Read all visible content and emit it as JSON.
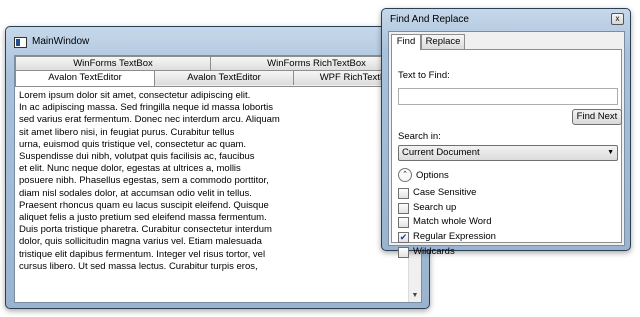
{
  "main_window": {
    "title": "MainWindow",
    "tabs_row1": [
      "WinForms TextBox",
      "WinForms RichTextBox"
    ],
    "tabs_row2": [
      "Avalon TextEditor",
      "Avalon TextEditor",
      "WPF RichTextBox"
    ],
    "active_tab": "Avalon TextEditor",
    "editor_lines": [
      "Lorem ipsum dolor sit amet, consectetur adipiscing elit.",
      "In ac adipiscing massa. Sed fringilla neque id massa lobortis",
      "sed varius erat fermentum. Donec nec interdum arcu. Aliquam",
      "sit amet libero nisi, in feugiat purus. Curabitur tellus",
      "urna, euismod quis tristique vel, consectetur ac quam.",
      "Suspendisse dui nibh, volutpat quis facilisis ac, faucibus",
      "et elit. Nunc neque dolor, egestas at ultrices a, mollis",
      "posuere nibh. Phasellus egestas, sem a commodo porttitor,",
      "diam nisl sodales dolor, at accumsan odio velit in tellus.",
      "Praesent rhoncus quam eu lacus suscipit eleifend. Quisque",
      "aliquet felis a justo pretium sed eleifend massa fermentum.",
      "Duis porta tristique pharetra. Curabitur consectetur interdum",
      "dolor, quis sollicitudin magna varius vel. Etiam malesuada",
      "tristique elit dapibus fermentum. Integer vel risus tortor, vel",
      "cursus libero. Ut sed massa lectus. Curabitur turpis eros,"
    ]
  },
  "find_replace": {
    "title": "Find And Replace",
    "close_glyph": "x",
    "tabs": [
      "Find",
      "Replace"
    ],
    "active_tab": "Find",
    "text_to_find_label": "Text to Find:",
    "text_to_find_value": "",
    "find_next_label": "Find Next",
    "search_in_label": "Search in:",
    "search_in_value": "Current Document",
    "options_label": "Options",
    "options": [
      {
        "label": "Case Sensitive",
        "checked": false
      },
      {
        "label": "Search up",
        "checked": false
      },
      {
        "label": "Match whole Word",
        "checked": false
      },
      {
        "label": "Regular Expression",
        "checked": true
      },
      {
        "label": "Wildcards",
        "checked": false
      }
    ]
  }
}
